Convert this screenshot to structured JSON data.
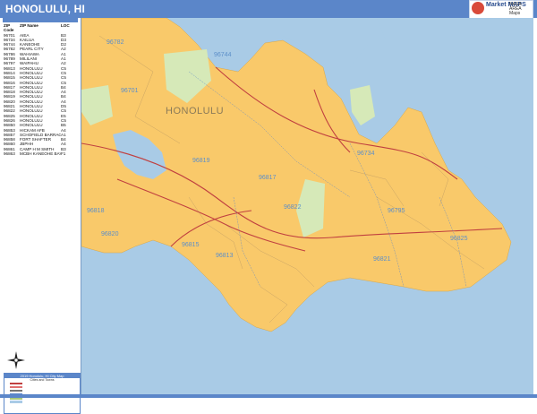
{
  "header": {
    "title": "HONOLULU, HI"
  },
  "logo": {
    "brand": "Market MAPS",
    "sub": "NASA AREA Maps"
  },
  "zip_index": {
    "columns": [
      "ZIP Code",
      "ZIP Name",
      "LOC"
    ],
    "rows": [
      [
        "96701",
        "AIEA",
        "B3"
      ],
      [
        "96734",
        "KAILUA",
        "D3"
      ],
      [
        "96744",
        "KANEOHE",
        "D2"
      ],
      [
        "96782",
        "PEARL CITY",
        "A2"
      ],
      [
        "96786",
        "WAHIAWA",
        "A1"
      ],
      [
        "96789",
        "MILILANI",
        "A1"
      ],
      [
        "96797",
        "WAIPAHU",
        "A2"
      ],
      [
        "96813",
        "HONOLULU",
        "C5"
      ],
      [
        "96814",
        "HONOLULU",
        "C5"
      ],
      [
        "96815",
        "HONOLULU",
        "C5"
      ],
      [
        "96816",
        "HONOLULU",
        "C5"
      ],
      [
        "96817",
        "HONOLULU",
        "B4"
      ],
      [
        "96818",
        "HONOLULU",
        "A4"
      ],
      [
        "96819",
        "HONOLULU",
        "B4"
      ],
      [
        "96820",
        "HONOLULU",
        "A4"
      ],
      [
        "96821",
        "HONOLULU",
        "D5"
      ],
      [
        "96822",
        "HONOLULU",
        "C5"
      ],
      [
        "96825",
        "HONOLULU",
        "E5"
      ],
      [
        "96826",
        "HONOLULU",
        "C5"
      ],
      [
        "96850",
        "HONOLULU",
        "B5"
      ],
      [
        "96853",
        "HICKAM AFB",
        "A4"
      ],
      [
        "96857",
        "SCHOFIELD BARRACKS",
        "A1"
      ],
      [
        "96858",
        "FORT SHAFTER",
        "B4"
      ],
      [
        "96860",
        "JBPHH",
        "A4"
      ],
      [
        "96861",
        "CAMP H M SMITH",
        "B3"
      ],
      [
        "96863",
        "MCBH KANEOHE BAY",
        "F1"
      ]
    ]
  },
  "legend": {
    "title": "2019 Honolulu, HI City Map",
    "subtitle": "Cities and Towns"
  },
  "map_labels": {
    "city": "HONOLULU",
    "zips": [
      {
        "code": "96782",
        "area": "nw"
      },
      {
        "code": "96744",
        "area": "n"
      },
      {
        "code": "96701",
        "area": "w"
      },
      {
        "code": "96819",
        "area": "center-w"
      },
      {
        "code": "96817",
        "area": "center"
      },
      {
        "code": "96734",
        "area": "e"
      },
      {
        "code": "96822",
        "area": "center-s"
      },
      {
        "code": "96795",
        "area": "se"
      },
      {
        "code": "96825",
        "area": "far-e"
      },
      {
        "code": "96818",
        "area": "sw"
      },
      {
        "code": "96821",
        "area": "s"
      },
      {
        "code": "96815",
        "area": "coast"
      },
      {
        "code": "96813",
        "area": "downtown"
      },
      {
        "code": "96820",
        "area": "airport"
      }
    ]
  },
  "colors": {
    "land": "#f9c96a",
    "water": "#a9cbe6",
    "park": "#d6e9b8",
    "accent": "#5b86c9",
    "roads": "#c04040"
  }
}
